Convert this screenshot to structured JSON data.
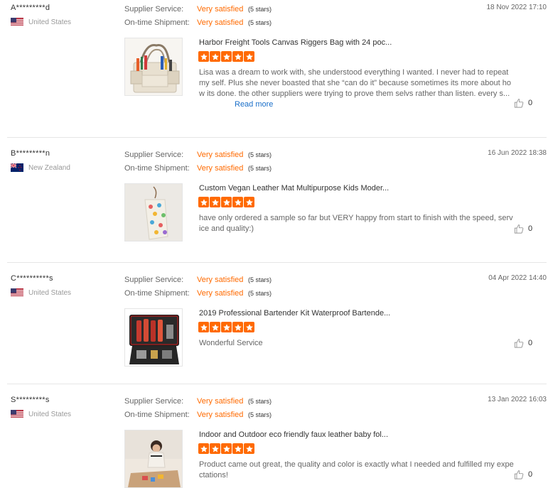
{
  "colors": {
    "accent": "#ff6a00",
    "link": "#1a6fc9",
    "divider": "#e6e6e6"
  },
  "labels": {
    "supplier_service": "Supplier Service:",
    "ontime_shipment": "On-time Shipment:"
  },
  "reviews": [
    {
      "buyer": "A*********d",
      "country": "United States",
      "flag_icon": "us-flag-icon",
      "supplier_value": "Very satisfied",
      "supplier_stars": "(5 stars)",
      "shipment_value": "Very satisfied",
      "shipment_stars": "(5 stars)",
      "date": "18 Nov 2022 17:10",
      "product_title": "Harbor Freight Tools Canvas Riggers Bag with 24 poc...",
      "rating": 5,
      "text": "Lisa was a dream to work with, she understood everything I wanted. I never had to repeat my self. Plus she never boasted that she “can do it” because sometimes its more about how its done. the other suppliers were trying to prove them selvs rather than listen. every s...",
      "read_more": "Read more",
      "helpful_count": "0"
    },
    {
      "buyer": "B*********n",
      "country": "New Zealand",
      "flag_icon": "nz-flag-icon",
      "supplier_value": "Very satisfied",
      "supplier_stars": "(5 stars)",
      "shipment_value": "Very satisfied",
      "shipment_stars": "(5 stars)",
      "date": "16 Jun 2022 18:38",
      "product_title": "Custom Vegan Leather Mat Multipurpose Kids Moder...",
      "rating": 5,
      "text": "have only ordered a sample so far but VERY happy from start to finish with the speed, service and quality:)",
      "helpful_count": "0"
    },
    {
      "buyer": "C**********s",
      "country": "United States",
      "flag_icon": "us-flag-icon",
      "supplier_value": "Very satisfied",
      "supplier_stars": "(5 stars)",
      "shipment_value": "Very satisfied",
      "shipment_stars": "(5 stars)",
      "date": "04 Apr 2022 14:40",
      "product_title": "2019 Professional Bartender Kit Waterproof Bartende...",
      "rating": 5,
      "text": "Wonderful Service",
      "helpful_count": "0"
    },
    {
      "buyer": "S*********s",
      "country": "United States",
      "flag_icon": "us-flag-icon",
      "supplier_value": "Very satisfied",
      "supplier_stars": "(5 stars)",
      "shipment_value": "Very satisfied",
      "shipment_stars": "(5 stars)",
      "date": "13 Jan 2022 16:03",
      "product_title": "Indoor and Outdoor eco friendly faux leather baby fol...",
      "rating": 5,
      "text": "Product came out great, the quality and color is exactly what I needed and fulfilled my expectations!",
      "helpful_count": "0"
    }
  ]
}
